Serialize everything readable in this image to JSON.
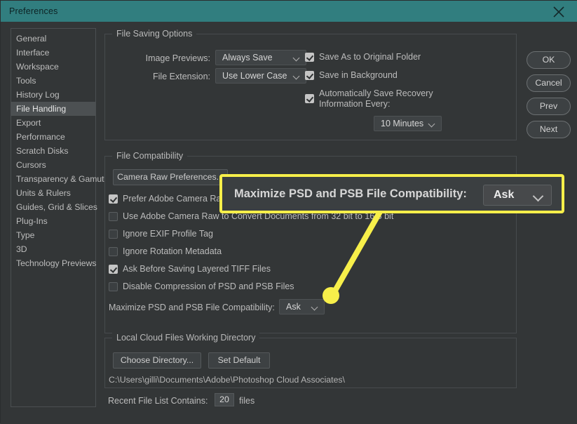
{
  "window": {
    "title": "Preferences",
    "close_icon": "close-x-icon",
    "accent_titlebar_color": "#317e7f",
    "background_color": "#333637",
    "annotation_color": "#f7ef4a"
  },
  "sidebar": {
    "items": [
      {
        "label": "General",
        "selected": false
      },
      {
        "label": "Interface",
        "selected": false
      },
      {
        "label": "Workspace",
        "selected": false
      },
      {
        "label": "Tools",
        "selected": false
      },
      {
        "label": "History Log",
        "selected": false
      },
      {
        "label": "File Handling",
        "selected": true
      },
      {
        "label": "Export",
        "selected": false
      },
      {
        "label": "Performance",
        "selected": false
      },
      {
        "label": "Scratch Disks",
        "selected": false
      },
      {
        "label": "Cursors",
        "selected": false
      },
      {
        "label": "Transparency & Gamut",
        "selected": false
      },
      {
        "label": "Units & Rulers",
        "selected": false
      },
      {
        "label": "Guides, Grid & Slices",
        "selected": false
      },
      {
        "label": "Plug-Ins",
        "selected": false
      },
      {
        "label": "Type",
        "selected": false
      },
      {
        "label": "3D",
        "selected": false
      },
      {
        "label": "Technology Previews",
        "selected": false
      }
    ]
  },
  "file_saving_options": {
    "group_title": "File Saving Options",
    "image_previews_label": "Image Previews:",
    "image_previews_value": "Always Save",
    "file_extension_label": "File Extension:",
    "file_extension_value": "Use Lower Case",
    "save_as_original_folder": {
      "label": "Save As to Original Folder",
      "checked": true
    },
    "save_in_background": {
      "label": "Save in Background",
      "checked": true
    },
    "auto_save_recovery": {
      "label_line1": "Automatically Save Recovery",
      "label_line2": "Information Every:",
      "checked": true
    },
    "auto_save_interval_value": "10 Minutes"
  },
  "file_compatibility": {
    "group_title": "File Compatibility",
    "camera_raw_button": "Camera Raw Preferences...",
    "checkboxes": [
      {
        "label": "Prefer Adobe Camera Raw for Supported Raw Files",
        "checked": true,
        "truncated": true
      },
      {
        "label": "Use Adobe Camera Raw to Convert Documents from 32 bit to 16/8 bit",
        "checked": false,
        "truncated": true
      },
      {
        "label": "Ignore EXIF Profile Tag",
        "checked": false,
        "truncated": false
      },
      {
        "label": "Ignore Rotation Metadata",
        "checked": false,
        "truncated": false
      },
      {
        "label": "Ask Before Saving Layered TIFF Files",
        "checked": true,
        "truncated": false
      },
      {
        "label": "Disable Compression of PSD and PSB Files",
        "checked": false,
        "truncated": false
      }
    ],
    "maximize_label": "Maximize PSD and PSB File Compatibility:",
    "maximize_value": "Ask"
  },
  "local_cloud": {
    "group_title": "Local Cloud Files Working Directory",
    "choose_directory_button": "Choose Directory...",
    "set_default_button": "Set Default",
    "path": "C:\\Users\\gilli\\Documents\\Adobe\\Photoshop Cloud Associates\\"
  },
  "recent_files": {
    "label": "Recent File List Contains:",
    "value": "20",
    "suffix": "files"
  },
  "actions": {
    "ok": "OK",
    "cancel": "Cancel",
    "prev": "Prev",
    "next": "Next"
  },
  "callout": {
    "label": "Maximize PSD and PSB File Compatibility:",
    "value": "Ask"
  }
}
